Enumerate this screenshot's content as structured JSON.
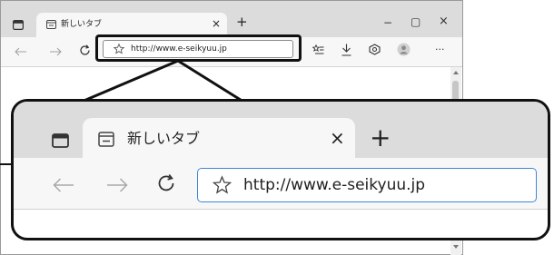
{
  "browser": {
    "tab_title": "新しいタブ",
    "close_tab_symbol": "×",
    "new_tab_symbol": "+",
    "address_url": "http://www.e-seikyuu.jp",
    "window_controls": {
      "minimize": "−",
      "maximize": "▢",
      "close": "×"
    },
    "more_symbol": "···",
    "icons": [
      "tab-actions-icon",
      "new-tab-page-icon",
      "back-icon",
      "forward-icon",
      "refresh-icon",
      "favorite-star-icon",
      "favorites-list-icon",
      "downloads-icon",
      "extensions-icon",
      "profile-icon",
      "more-icon"
    ]
  },
  "zoom": {
    "tab_title": "新しいタブ",
    "close_tab_symbol": "×",
    "new_tab_symbol": "+",
    "address_url": "http://www.e-seikyuu.jp"
  },
  "colors": {
    "tabstrip": "#dcdcdc",
    "toolbar": "#f7f7f7",
    "focus_border": "#3f86d9",
    "highlight_border": "#111111"
  }
}
